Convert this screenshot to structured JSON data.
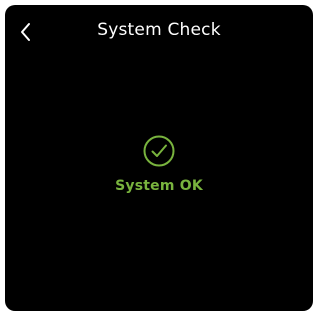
{
  "header": {
    "title": "System Check",
    "back_icon": "chevron-left-icon"
  },
  "status": {
    "icon": "check-circle-icon",
    "label": "System OK",
    "color": "#79b43e"
  },
  "colors": {
    "background": "#000000",
    "text": "#ffffff",
    "accent": "#79b43e"
  }
}
